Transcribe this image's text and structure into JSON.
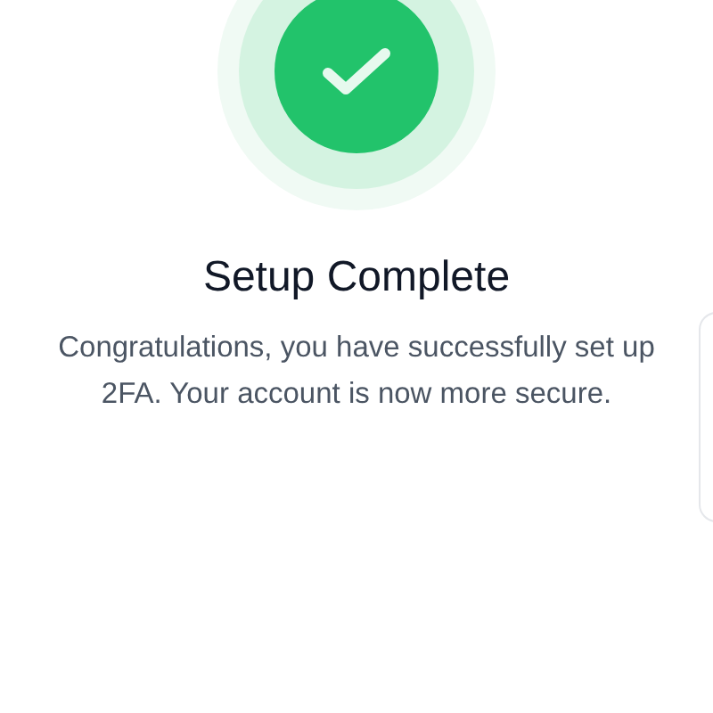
{
  "title": "Setup Complete",
  "message": "Congratulations, you have successfully set up 2FA. Your account is now more secure."
}
